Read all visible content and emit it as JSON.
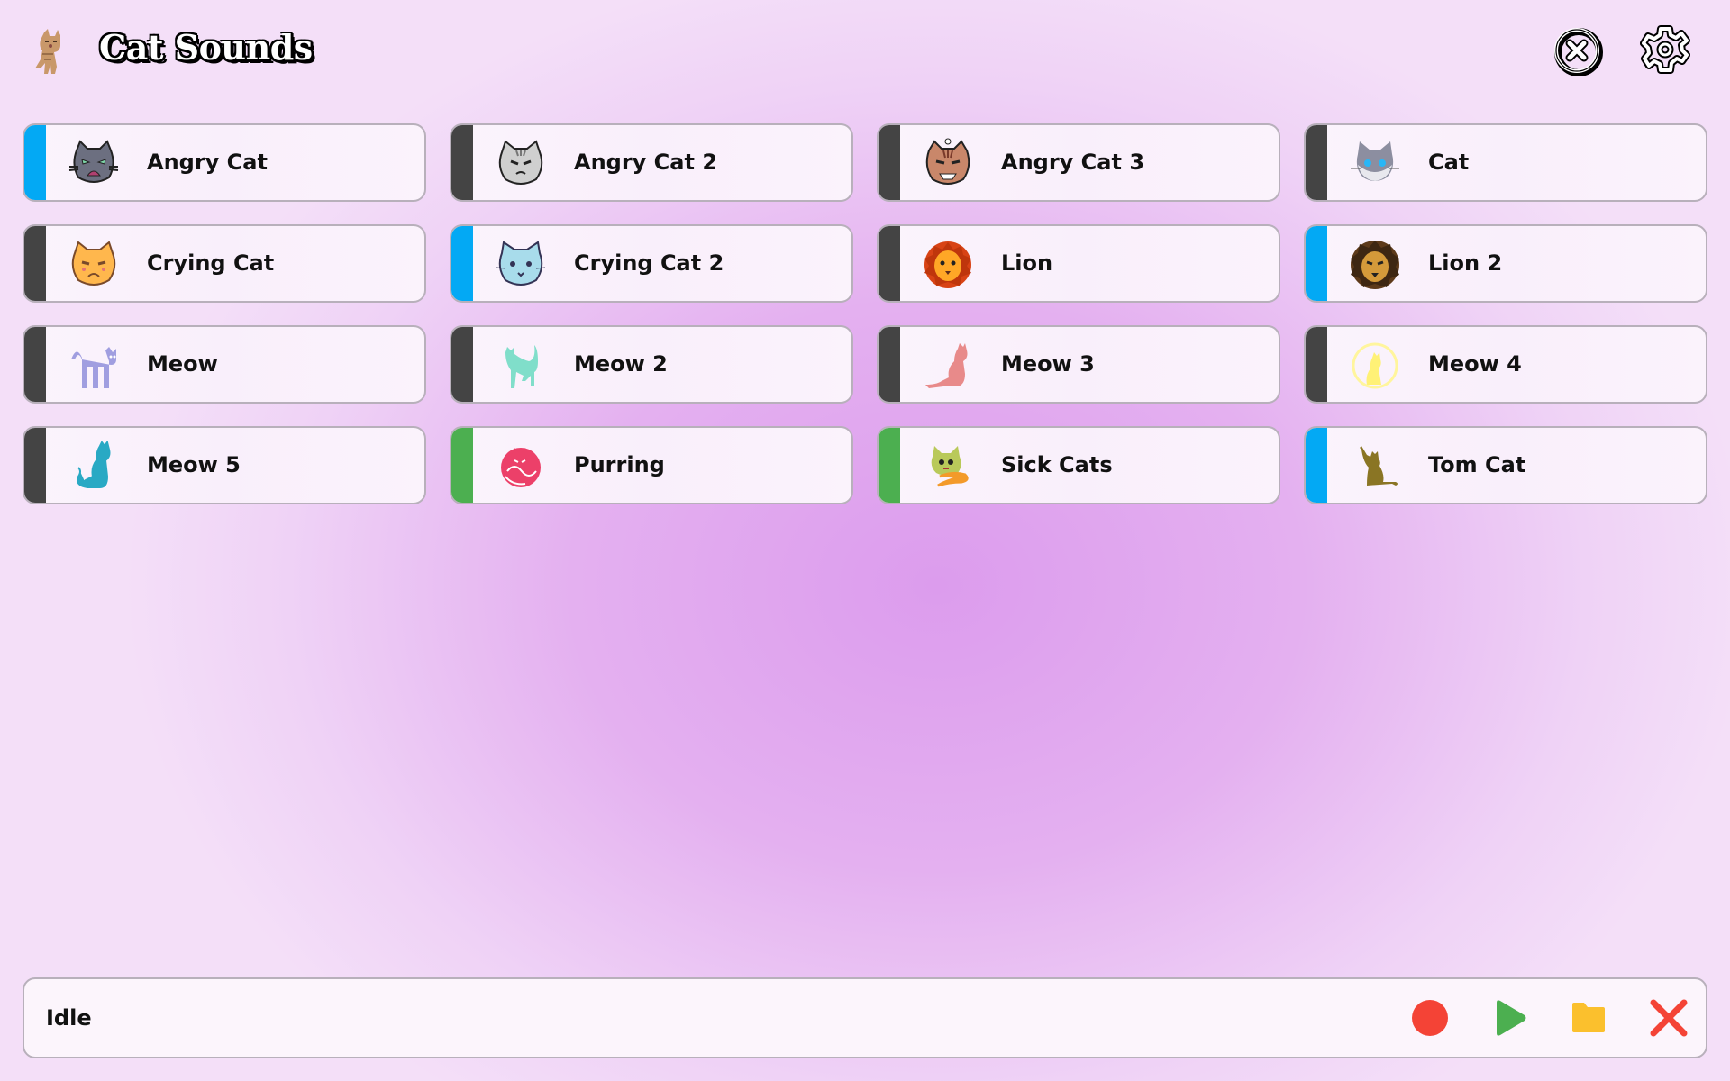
{
  "header": {
    "logo_icon": "kitten-photo-icon",
    "title": "Cat Sounds",
    "close_button": "close-circle-icon",
    "settings_button": "gear-icon"
  },
  "colors": {
    "bar_blue": "#03a9f4",
    "bar_dark": "#444444",
    "bar_green": "#4caf50",
    "record_red": "#f44336",
    "play_green": "#4caf50",
    "folder_yellow": "#fbc02d",
    "cancel_red": "#f44336"
  },
  "sounds": [
    {
      "label": "Angry Cat",
      "icon": "angry-cat-face-icon",
      "bar": "blue"
    },
    {
      "label": "Angry Cat 2",
      "icon": "grumpy-cat-face-icon",
      "bar": "dark"
    },
    {
      "label": "Angry Cat 3",
      "icon": "tabby-cat-face-icon",
      "bar": "dark"
    },
    {
      "label": "Cat",
      "icon": "grey-cat-face-icon",
      "bar": "dark"
    },
    {
      "label": "Crying Cat",
      "icon": "crying-cat-face-icon",
      "bar": "dark"
    },
    {
      "label": "Crying Cat 2",
      "icon": "blue-crying-cat-icon",
      "bar": "blue"
    },
    {
      "label": "Lion",
      "icon": "lion-face-icon",
      "bar": "dark"
    },
    {
      "label": "Lion 2",
      "icon": "lion-head-icon",
      "bar": "blue"
    },
    {
      "label": "Meow",
      "icon": "arched-cat-icon",
      "bar": "dark"
    },
    {
      "label": "Meow 2",
      "icon": "standing-cat-icon",
      "bar": "dark"
    },
    {
      "label": "Meow 3",
      "icon": "sitting-cat-icon",
      "bar": "dark"
    },
    {
      "label": "Meow 4",
      "icon": "moon-cat-icon",
      "bar": "dark"
    },
    {
      "label": "Meow 5",
      "icon": "blue-sitting-cat-icon",
      "bar": "dark"
    },
    {
      "label": "Purring",
      "icon": "curled-cat-icon",
      "bar": "green"
    },
    {
      "label": "Sick Cats",
      "icon": "sick-cat-icon",
      "bar": "green"
    },
    {
      "label": "Tom Cat",
      "icon": "waving-cat-icon",
      "bar": "blue"
    }
  ],
  "status": {
    "text": "Idle",
    "controls": [
      "record",
      "play",
      "open-folder",
      "cancel"
    ]
  }
}
